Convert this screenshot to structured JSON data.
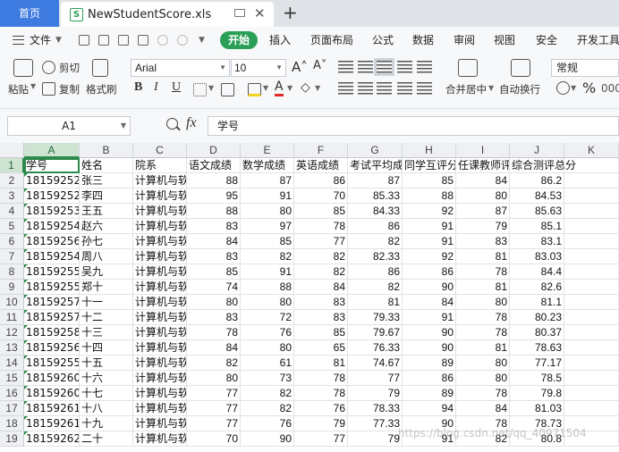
{
  "tabs": {
    "home_label": "首页",
    "file_name": "NewStudentScore.xls",
    "file_icon_letter": "S",
    "add_label": "+"
  },
  "menu": {
    "file_label": "文件",
    "start_label": "开始",
    "items": [
      "插入",
      "页面布局",
      "公式",
      "数据",
      "审阅",
      "视图",
      "安全",
      "开发工具"
    ]
  },
  "ribbon": {
    "paste_label": "粘贴",
    "cut_label": "剪切",
    "copy_label": "复制",
    "format_painter_label": "格式刷",
    "font_name": "Arial",
    "font_size": "10",
    "bold_label": "B",
    "italic_label": "I",
    "underline_label": "U",
    "merge_label": "合并居中",
    "wrap_label": "自动换行",
    "number_format": "常规",
    "percent_label": "%"
  },
  "formula_bar": {
    "cell_ref": "A1",
    "fx_label": "fx",
    "content": "学号"
  },
  "sheet": {
    "columns": [
      "A",
      "B",
      "C",
      "D",
      "E",
      "F",
      "G",
      "H",
      "I",
      "J",
      "K"
    ],
    "rows": [
      "1",
      "2",
      "3",
      "4",
      "5",
      "6",
      "7",
      "8",
      "9",
      "10",
      "11",
      "12",
      "13",
      "14",
      "15",
      "16",
      "17",
      "18",
      "19"
    ],
    "header_row": [
      "学号",
      "姓名",
      "院系",
      "语文成绩",
      "数学成绩",
      "英语成绩",
      "考试平均成",
      "同学互评分",
      "任课教师评",
      "综合测评总分"
    ],
    "records": [
      [
        "18159252",
        "张三",
        "计算机与软",
        "88",
        "87",
        "86",
        "87",
        "85",
        "84",
        "86.2"
      ],
      [
        "18159252",
        "李四",
        "计算机与软",
        "95",
        "91",
        "70",
        "85.33",
        "88",
        "80",
        "84.53"
      ],
      [
        "18159253",
        "王五",
        "计算机与软",
        "88",
        "80",
        "85",
        "84.33",
        "92",
        "87",
        "85.63"
      ],
      [
        "18159254",
        "赵六",
        "计算机与软",
        "83",
        "97",
        "78",
        "86",
        "91",
        "79",
        "85.1"
      ],
      [
        "18159256",
        "孙七",
        "计算机与软",
        "84",
        "85",
        "77",
        "82",
        "91",
        "83",
        "83.1"
      ],
      [
        "18159254",
        "周八",
        "计算机与软",
        "83",
        "82",
        "82",
        "82.33",
        "92",
        "81",
        "83.03"
      ],
      [
        "18159255",
        "吴九",
        "计算机与软",
        "85",
        "91",
        "82",
        "86",
        "86",
        "78",
        "84.4"
      ],
      [
        "18159255",
        "郑十",
        "计算机与软",
        "74",
        "88",
        "84",
        "82",
        "90",
        "81",
        "82.6"
      ],
      [
        "18159257",
        "十一",
        "计算机与软",
        "80",
        "80",
        "83",
        "81",
        "84",
        "80",
        "81.1"
      ],
      [
        "18159257",
        "十二",
        "计算机与软",
        "83",
        "72",
        "83",
        "79.33",
        "91",
        "78",
        "80.23"
      ],
      [
        "18159258",
        "十三",
        "计算机与软",
        "78",
        "76",
        "85",
        "79.67",
        "90",
        "78",
        "80.37"
      ],
      [
        "18159256",
        "十四",
        "计算机与软",
        "84",
        "80",
        "65",
        "76.33",
        "90",
        "81",
        "78.63"
      ],
      [
        "18159255",
        "十五",
        "计算机与软",
        "82",
        "61",
        "81",
        "74.67",
        "89",
        "80",
        "77.17"
      ],
      [
        "18159260",
        "十六",
        "计算机与软",
        "80",
        "73",
        "78",
        "77",
        "86",
        "80",
        "78.5"
      ],
      [
        "18159260",
        "十七",
        "计算机与软",
        "77",
        "82",
        "78",
        "79",
        "89",
        "78",
        "79.8"
      ],
      [
        "18159261",
        "十八",
        "计算机与软",
        "77",
        "82",
        "76",
        "78.33",
        "94",
        "84",
        "81.03"
      ],
      [
        "18159261",
        "十九",
        "计算机与软",
        "77",
        "76",
        "79",
        "77.33",
        "90",
        "78",
        "78.73"
      ],
      [
        "18159262",
        "二十",
        "计算机与软",
        "70",
        "90",
        "77",
        "79",
        "91",
        "82",
        "80.8"
      ]
    ]
  },
  "watermark": "https://blog.csdn.net/qq_40971504"
}
